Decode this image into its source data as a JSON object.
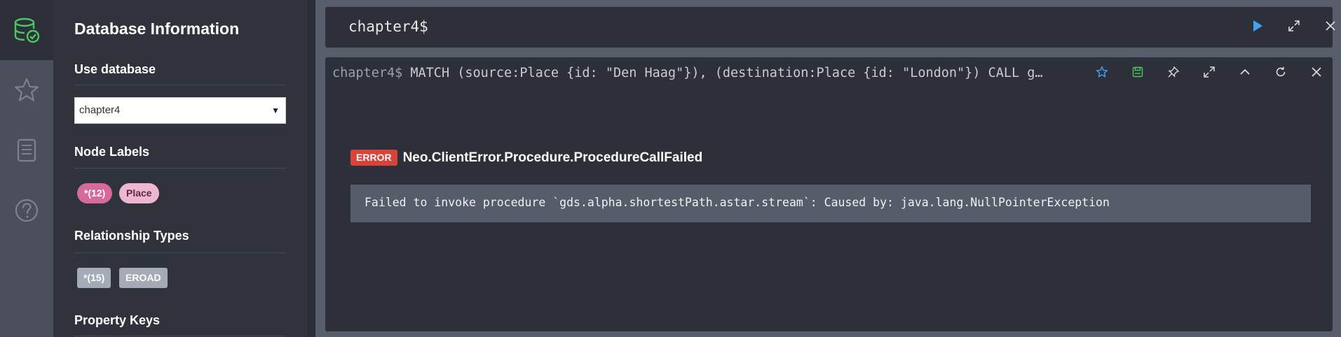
{
  "rail": {
    "items": [
      {
        "icon": "database-check-icon",
        "active": true
      },
      {
        "icon": "star-icon",
        "active": false
      },
      {
        "icon": "document-icon",
        "active": false
      },
      {
        "icon": "help-icon",
        "active": false
      }
    ],
    "accent": "#4cc764"
  },
  "drawer": {
    "title": "Database Information",
    "use_database_label": "Use database",
    "selected_database": "chapter4",
    "node_labels_title": "Node Labels",
    "node_labels": [
      {
        "label": "*(12)"
      },
      {
        "label": "Place"
      }
    ],
    "relationship_types_title": "Relationship Types",
    "relationship_types": [
      {
        "label": "*(15)"
      },
      {
        "label": "EROAD"
      }
    ],
    "property_keys_title": "Property Keys"
  },
  "editor": {
    "prompt": "chapter4$",
    "buttons": [
      "play-icon",
      "expand-icon",
      "close-icon"
    ],
    "play_color": "#3fa2f7"
  },
  "frame": {
    "prompt": "chapter4$",
    "query": " MATCH (source:Place {id: \"Den Haag\"}), (destination:Place {id: \"London\"}) CALL g…",
    "buttons": [
      "star-icon",
      "save-icon",
      "pin-icon",
      "expand-icon",
      "collapse-icon",
      "rerun-icon",
      "close-icon"
    ],
    "error": {
      "badge": "ERROR",
      "code": "Neo.ClientError.Procedure.ProcedureCallFailed",
      "message": "Failed to invoke procedure `gds.alpha.shortestPath.astar.stream`: Caused by: java.lang.NullPointerException",
      "badge_color": "#d9443a"
    }
  }
}
